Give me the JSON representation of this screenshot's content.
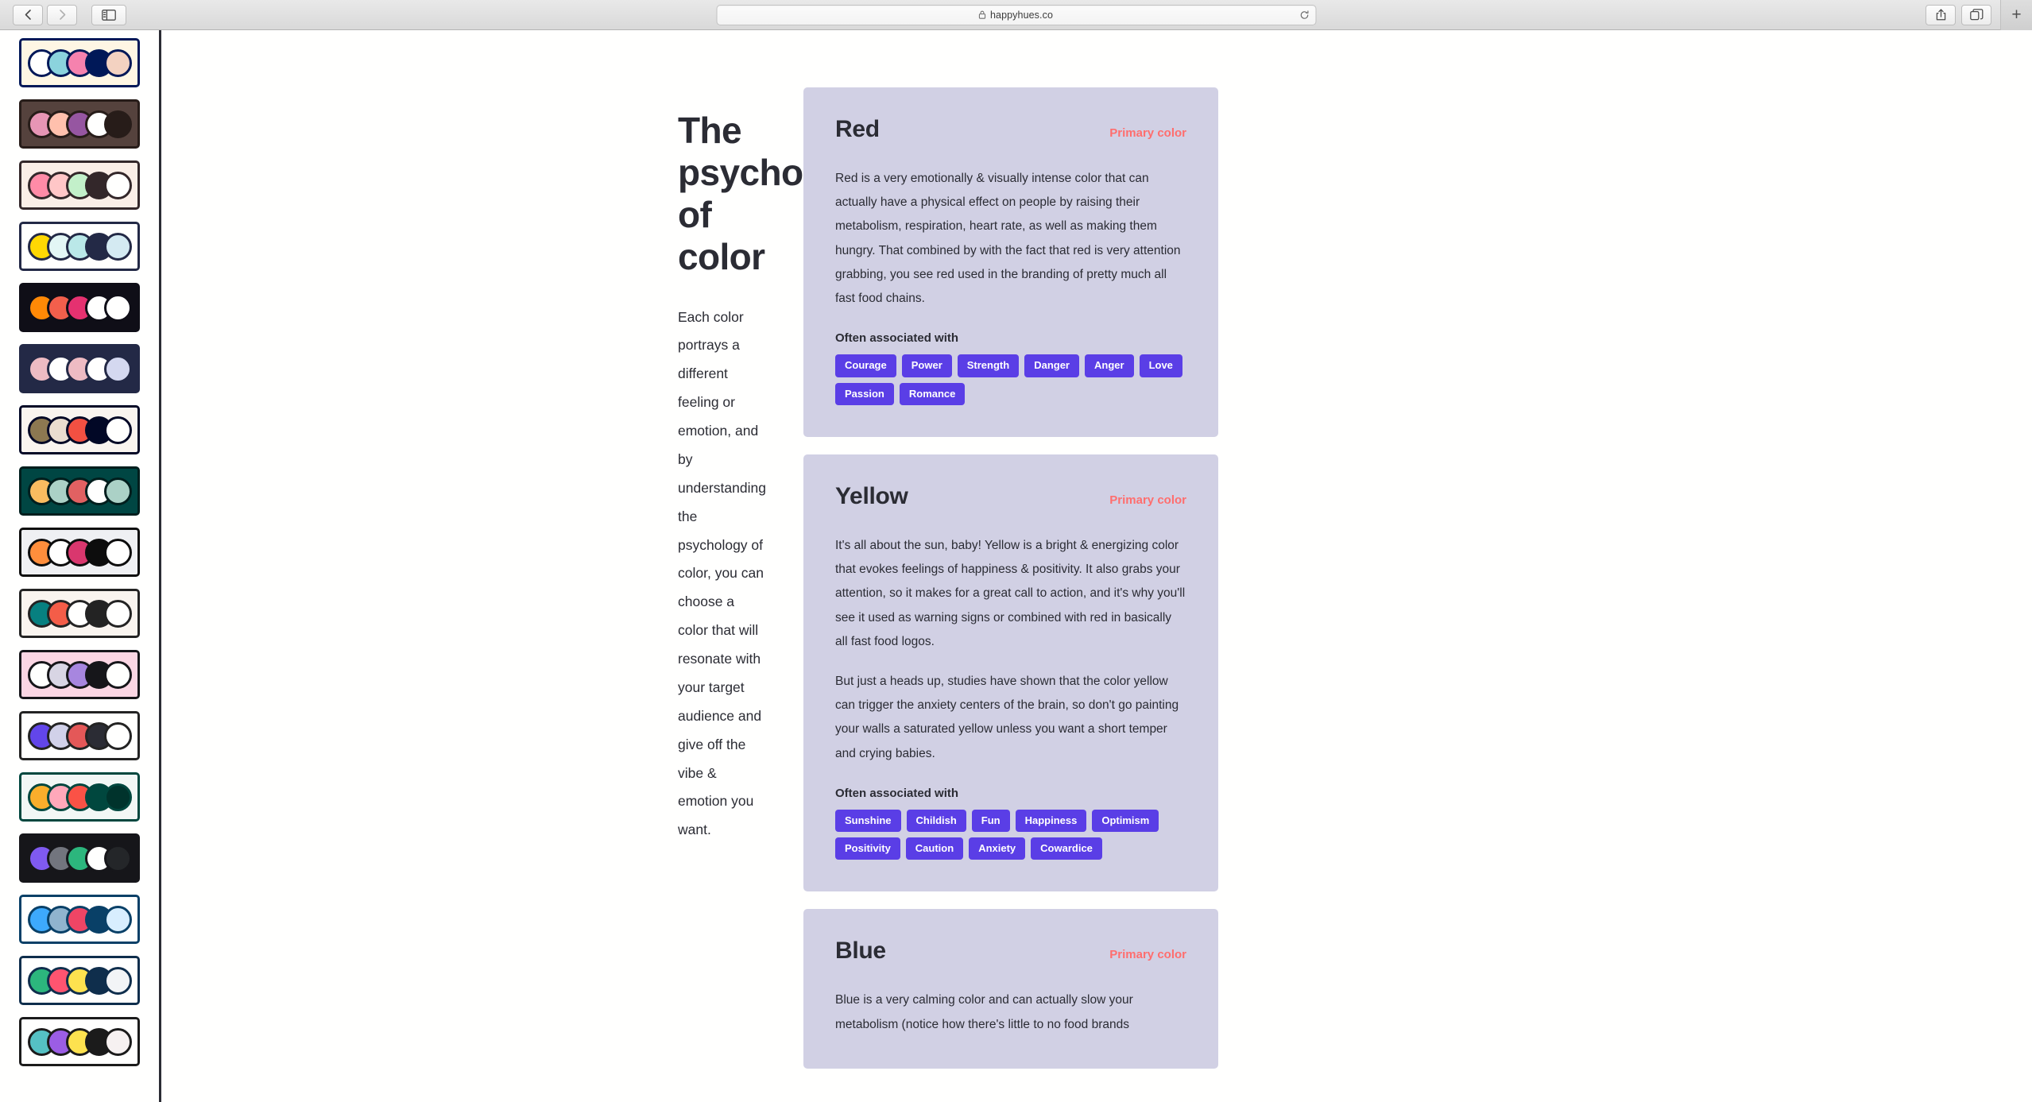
{
  "browser": {
    "back_label": "Back",
    "forward_label": "Forward",
    "sidebar_toggle_label": "Show sidebar",
    "url": "happyhues.co",
    "lock_icon": "lock-icon",
    "reload_icon": "reload-icon",
    "share_icon": "share-icon",
    "tabs_icon": "tabs-overview-icon",
    "new_tab_label": "+"
  },
  "palette_rail": {
    "palettes": [
      {
        "name": "palette-1",
        "selected": true,
        "bg": "#fef6e4",
        "border": "#001858",
        "swatches": [
          "#fffffe",
          "#8bd3dd",
          "#f582ae",
          "#001858",
          "#f3d2c1"
        ]
      },
      {
        "name": "palette-2",
        "selected": false,
        "bg": "#55423d",
        "border": "#271c19",
        "swatches": [
          "#e695b5",
          "#ffc0ad",
          "#9656a1",
          "#fffffe",
          "#271c19"
        ]
      },
      {
        "name": "palette-3",
        "selected": false,
        "bg": "#faeee7",
        "border": "#33272a",
        "swatches": [
          "#ff8ba7",
          "#ffc6c7",
          "#c3f0ca",
          "#33272a",
          "#fffffe"
        ]
      },
      {
        "name": "palette-4",
        "selected": false,
        "bg": "#fffffe",
        "border": "#232946",
        "swatches": [
          "#ffd803",
          "#e3f6f5",
          "#bae8e8",
          "#232946",
          "#d4eaf2"
        ]
      },
      {
        "name": "palette-5",
        "selected": false,
        "bg": "#0f0e17",
        "border": "#0f0e17",
        "swatches": [
          "#ff8906",
          "#f25f4c",
          "#e53170",
          "#fffffe",
          "#fffffe"
        ]
      },
      {
        "name": "palette-6",
        "selected": false,
        "bg": "#232946",
        "border": "#232946",
        "swatches": [
          "#eebbc3",
          "#fffffe",
          "#eebbc3",
          "#fffffe",
          "#d4d8f0"
        ]
      },
      {
        "name": "palette-7",
        "selected": false,
        "bg": "#f9f4ef",
        "border": "#020826",
        "swatches": [
          "#8c7851",
          "#eaddcf",
          "#f25042",
          "#020826",
          "#fffffe"
        ]
      },
      {
        "name": "palette-8",
        "selected": false,
        "bg": "#004643",
        "border": "#001e1d",
        "swatches": [
          "#f9bc60",
          "#abd1c6",
          "#e16162",
          "#fffffe",
          "#abd1c6"
        ]
      },
      {
        "name": "palette-9",
        "selected": false,
        "bg": "#eff0f3",
        "border": "#0d0d0d",
        "swatches": [
          "#ff8e3c",
          "#fffffe",
          "#d9376e",
          "#0d0d0d",
          "#fffffe"
        ]
      },
      {
        "name": "palette-10",
        "selected": false,
        "bg": "#f9f4ef",
        "border": "#232323",
        "swatches": [
          "#078080",
          "#f45d48",
          "#fffffe",
          "#232323",
          "#fffffe"
        ]
      },
      {
        "name": "palette-11",
        "selected": false,
        "bg": "#fbd6e4",
        "border": "#16161a",
        "swatches": [
          "#fffffe",
          "#d8d5e4",
          "#a786df",
          "#16161a",
          "#fffffe"
        ]
      },
      {
        "name": "palette-12",
        "selected": false,
        "bg": "#fffffe",
        "border": "#232323",
        "swatches": [
          "#6246ea",
          "#d1d1e9",
          "#e45858",
          "#2b2c34",
          "#fffffe"
        ]
      },
      {
        "name": "palette-13",
        "selected": false,
        "bg": "#f2f7f5",
        "border": "#00473e",
        "swatches": [
          "#faae2b",
          "#ffa8ba",
          "#fa5246",
          "#00473e",
          "#00332c"
        ]
      },
      {
        "name": "palette-14",
        "selected": false,
        "bg": "#16161a",
        "border": "#16161a",
        "swatches": [
          "#7f5af0",
          "#72757e",
          "#2cb67d",
          "#fffffe",
          "#242629"
        ]
      },
      {
        "name": "palette-15",
        "selected": false,
        "bg": "#fffffe",
        "border": "#094067",
        "swatches": [
          "#3da9fc",
          "#90b4ce",
          "#ef4565",
          "#094067",
          "#d8eefe"
        ]
      },
      {
        "name": "palette-16",
        "selected": false,
        "bg": "#fffffe",
        "border": "#0f2e4c",
        "swatches": [
          "#2cb67d",
          "#ff5470",
          "#fde24f",
          "#0f2e4c",
          "#f2f4f6"
        ]
      },
      {
        "name": "palette-17",
        "selected": false,
        "bg": "#fffffe",
        "border": "#1b1b1b",
        "swatches": [
          "#55c1c4",
          "#9b5de5",
          "#fde24f",
          "#1b1b1b",
          "#f6f1f1"
        ]
      }
    ]
  },
  "intro": {
    "heading": "The psychology of color",
    "paragraph": "Each color portrays a different feeling or emotion, and by understanding the psychology of color, you can choose a color that will resonate with your target audience and give off the vibe & emotion you want."
  },
  "cards": [
    {
      "title": "Red",
      "badge": "Primary color",
      "paragraphs": [
        "Red is a very emotionally & visually intense color that can actually have a physical effect on people by raising their metabolism, respiration, heart rate, as well as making them hungry. That combined by with the fact that red is very attention grabbing, you see red used in the branding of pretty much all fast food chains."
      ],
      "assoc_label": "Often associated with",
      "tags": [
        "Courage",
        "Power",
        "Strength",
        "Danger",
        "Anger",
        "Love",
        "Passion",
        "Romance"
      ]
    },
    {
      "title": "Yellow",
      "badge": "Primary color",
      "paragraphs": [
        "It's all about the sun, baby! Yellow is a bright & energizing color that evokes feelings of happiness & positivity. It also grabs your attention, so it makes for a great call to action, and it's why you'll see it used as warning signs or combined with red in basically all fast food logos.",
        "But just a heads up, studies have shown that the color yellow can trigger the anxiety centers of the brain, so don't go painting your walls a saturated yellow unless you want a short temper and crying babies."
      ],
      "assoc_label": "Often associated with",
      "tags": [
        "Sunshine",
        "Childish",
        "Fun",
        "Happiness",
        "Optimism",
        "Positivity",
        "Caution",
        "Anxiety",
        "Cowardice"
      ]
    },
    {
      "title": "Blue",
      "badge": "Primary color",
      "paragraphs": [
        "Blue is a very calming color and can actually slow your metabolism (notice how there's little to no food brands"
      ],
      "assoc_label": "",
      "tags": []
    }
  ],
  "theme": {
    "card_bg": "#d1d0e4",
    "tag_bg": "#5a3ee6",
    "badge_color": "#ff6e6e",
    "text_color": "#2b2c34",
    "rail_border": "#2b2c34"
  }
}
